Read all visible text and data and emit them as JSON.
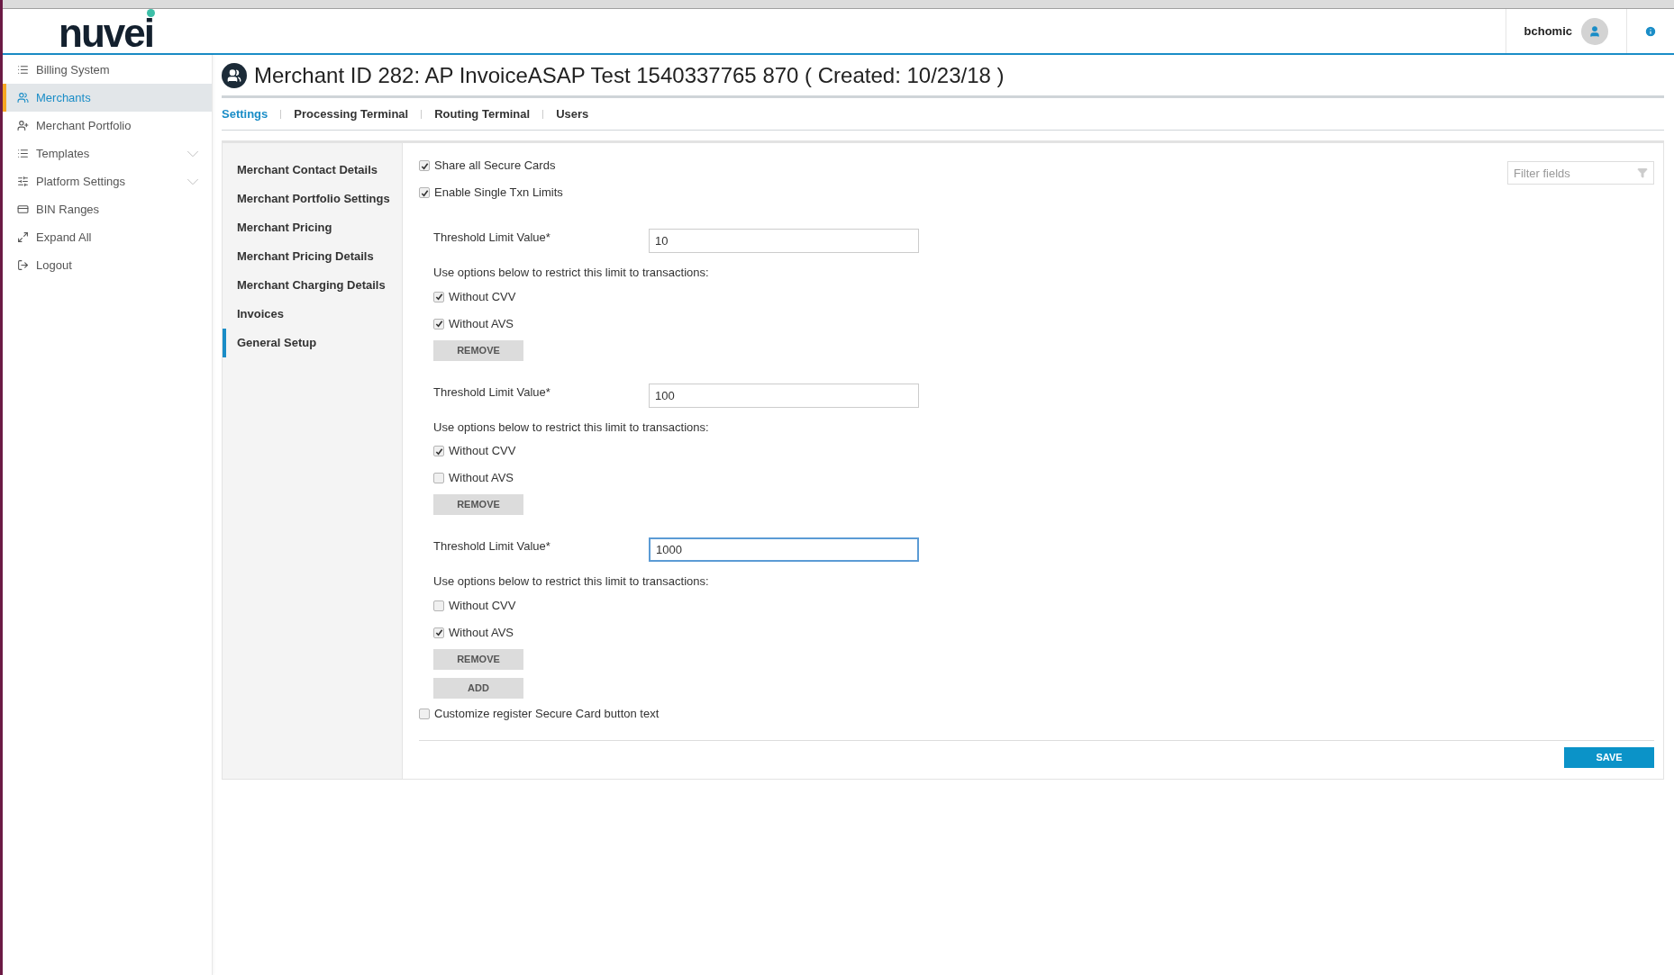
{
  "header": {
    "logo": "nuvei",
    "username": "bchomic"
  },
  "sidebar": {
    "items": [
      {
        "label": "Billing System",
        "selected": false,
        "expandable": false
      },
      {
        "label": "Merchants",
        "selected": true,
        "expandable": false
      },
      {
        "label": "Merchant Portfolio",
        "selected": false,
        "expandable": false
      },
      {
        "label": "Templates",
        "selected": false,
        "expandable": true
      },
      {
        "label": "Platform Settings",
        "selected": false,
        "expandable": true
      },
      {
        "label": "BIN Ranges",
        "selected": false,
        "expandable": false
      },
      {
        "label": "Expand All",
        "selected": false,
        "expandable": false
      },
      {
        "label": "Logout",
        "selected": false,
        "expandable": false
      }
    ]
  },
  "page": {
    "title": "Merchant ID 282: AP InvoiceASAP Test 1540337765 870 ( Created: 10/23/18 )",
    "tabs": [
      {
        "label": "Settings",
        "selected": true
      },
      {
        "label": "Processing Terminal",
        "selected": false
      },
      {
        "label": "Routing Terminal",
        "selected": false
      },
      {
        "label": "Users",
        "selected": false
      }
    ]
  },
  "subnav": {
    "items": [
      {
        "label": "Merchant Contact Details",
        "selected": false
      },
      {
        "label": "Merchant Portfolio Settings",
        "selected": false
      },
      {
        "label": "Merchant Pricing",
        "selected": false
      },
      {
        "label": "Merchant Pricing Details",
        "selected": false
      },
      {
        "label": "Merchant Charging Details",
        "selected": false
      },
      {
        "label": "Invoices",
        "selected": false
      },
      {
        "label": "General Setup",
        "selected": true
      }
    ]
  },
  "form": {
    "filter": {
      "placeholder": "Filter fields"
    },
    "top_options": [
      {
        "label": "Share all Secure Cards",
        "checked": true
      },
      {
        "label": "Enable Single Txn Limits",
        "checked": true
      }
    ],
    "limits": [
      {
        "label": "Threshold Limit Value*",
        "value": "10",
        "focused": false,
        "hint": "Use options below to restrict this limit to transactions:",
        "options": [
          {
            "label": "Without CVV",
            "checked": true
          },
          {
            "label": "Without AVS",
            "checked": true
          }
        ],
        "remove": "REMOVE"
      },
      {
        "label": "Threshold Limit Value*",
        "value": "100",
        "focused": false,
        "hint": "Use options below to restrict this limit to transactions:",
        "options": [
          {
            "label": "Without CVV",
            "checked": true
          },
          {
            "label": "Without AVS",
            "checked": false
          }
        ],
        "remove": "REMOVE"
      },
      {
        "label": "Threshold Limit Value*",
        "value": "1000",
        "focused": true,
        "hint": "Use options below to restrict this limit to transactions:",
        "options": [
          {
            "label": "Without CVV",
            "checked": false
          },
          {
            "label": "Without AVS",
            "checked": true
          }
        ],
        "remove": "REMOVE"
      }
    ],
    "add": "ADD",
    "customize": {
      "label": "Customize register Secure Card button text",
      "checked": false
    },
    "save": "SAVE"
  }
}
